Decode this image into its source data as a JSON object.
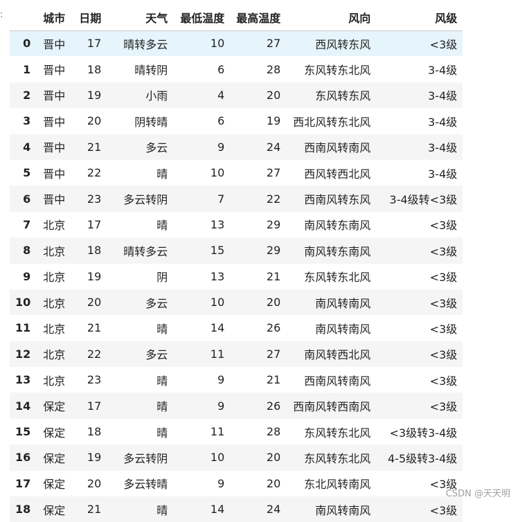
{
  "prompt_marker": ":",
  "table": {
    "columns": [
      "城市",
      "日期",
      "天气",
      "最低温度",
      "最高温度",
      "风向",
      "风级"
    ],
    "rows": [
      {
        "index": "0",
        "cells": [
          "晋中",
          "17",
          "晴转多云",
          "10",
          "27",
          "西风转东风",
          "<3级"
        ]
      },
      {
        "index": "1",
        "cells": [
          "晋中",
          "18",
          "晴转阴",
          "6",
          "28",
          "东风转东北风",
          "3-4级"
        ]
      },
      {
        "index": "2",
        "cells": [
          "晋中",
          "19",
          "小雨",
          "4",
          "20",
          "东风转东风",
          "3-4级"
        ]
      },
      {
        "index": "3",
        "cells": [
          "晋中",
          "20",
          "阴转晴",
          "6",
          "19",
          "西北风转东北风",
          "3-4级"
        ]
      },
      {
        "index": "4",
        "cells": [
          "晋中",
          "21",
          "多云",
          "9",
          "24",
          "西南风转南风",
          "3-4级"
        ]
      },
      {
        "index": "5",
        "cells": [
          "晋中",
          "22",
          "晴",
          "10",
          "27",
          "西风转西北风",
          "3-4级"
        ]
      },
      {
        "index": "6",
        "cells": [
          "晋中",
          "23",
          "多云转阴",
          "7",
          "22",
          "西南风转东风",
          "3-4级转<3级"
        ]
      },
      {
        "index": "7",
        "cells": [
          "北京",
          "17",
          "晴",
          "13",
          "29",
          "南风转东南风",
          "<3级"
        ]
      },
      {
        "index": "8",
        "cells": [
          "北京",
          "18",
          "晴转多云",
          "15",
          "29",
          "南风转东南风",
          "<3级"
        ]
      },
      {
        "index": "9",
        "cells": [
          "北京",
          "19",
          "阴",
          "13",
          "21",
          "东风转东北风",
          "<3级"
        ]
      },
      {
        "index": "10",
        "cells": [
          "北京",
          "20",
          "多云",
          "10",
          "20",
          "南风转南风",
          "<3级"
        ]
      },
      {
        "index": "11",
        "cells": [
          "北京",
          "21",
          "晴",
          "14",
          "26",
          "南风转南风",
          "<3级"
        ]
      },
      {
        "index": "12",
        "cells": [
          "北京",
          "22",
          "多云",
          "11",
          "27",
          "南风转西北风",
          "<3级"
        ]
      },
      {
        "index": "13",
        "cells": [
          "北京",
          "23",
          "晴",
          "9",
          "21",
          "西南风转南风",
          "<3级"
        ]
      },
      {
        "index": "14",
        "cells": [
          "保定",
          "17",
          "晴",
          "9",
          "26",
          "西南风转西南风",
          "<3级"
        ]
      },
      {
        "index": "15",
        "cells": [
          "保定",
          "18",
          "晴",
          "11",
          "28",
          "东风转东北风",
          "<3级转3-4级"
        ]
      },
      {
        "index": "16",
        "cells": [
          "保定",
          "19",
          "多云转阴",
          "10",
          "20",
          "东风转东北风",
          "4-5级转3-4级"
        ]
      },
      {
        "index": "17",
        "cells": [
          "保定",
          "20",
          "多云转晴",
          "9",
          "20",
          "东北风转南风",
          "<3级"
        ]
      },
      {
        "index": "18",
        "cells": [
          "保定",
          "21",
          "晴",
          "14",
          "24",
          "南风转南风",
          "<3级"
        ]
      }
    ]
  },
  "colors": {
    "row_stripe": "#f5f5f5",
    "row_hover": "#e6f4fb",
    "header_border": "#c9c9c9"
  },
  "watermark": "CSDN @天天明"
}
